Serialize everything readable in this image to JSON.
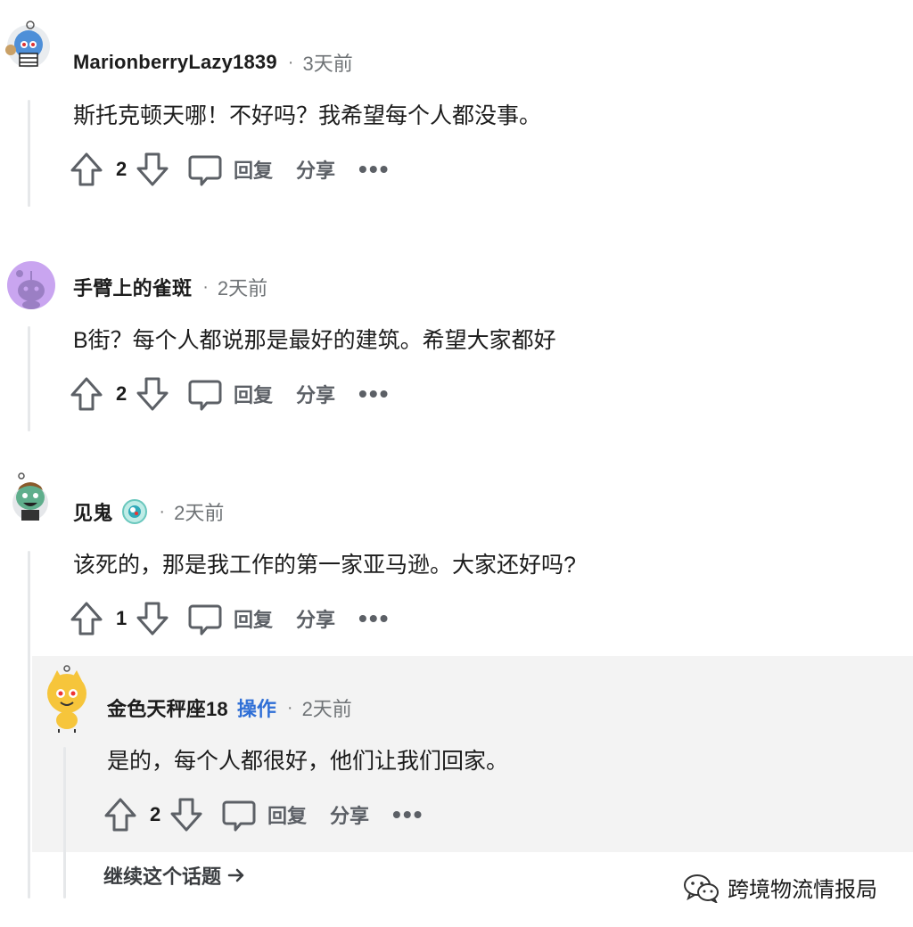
{
  "comments": [
    {
      "username": "MarionberryLazy1839",
      "time": "3天前",
      "body": "斯托克顿天哪！不好吗？我希望每个人都没事。",
      "score": "2",
      "reply_label": "回复",
      "share_label": "分享",
      "more_label": "•••"
    },
    {
      "username": "手臂上的雀斑",
      "time": "2天前",
      "body": "B街？每个人都说那是最好的建筑。希望大家都好",
      "score": "2",
      "reply_label": "回复",
      "share_label": "分享",
      "more_label": "•••"
    },
    {
      "username": "见鬼",
      "time": "2天前",
      "body": "该死的，那是我工作的第一家亚马逊。大家还好吗?",
      "score": "1",
      "reply_label": "回复",
      "share_label": "分享",
      "more_label": "•••"
    }
  ],
  "reply": {
    "username": "金色天秤座18",
    "op_badge": "操作",
    "time": "2天前",
    "body": "是的，每个人都很好，他们让我们回家。",
    "score": "2",
    "reply_label": "回复",
    "share_label": "分享",
    "more_label": "•••"
  },
  "continue_thread": "继续这个话题",
  "watermark": "跨境物流情报局",
  "colors": {
    "op_badge": "#2f6fd6",
    "reply_background": "#f3f3f3",
    "thread_line": "#e6e8ea"
  }
}
